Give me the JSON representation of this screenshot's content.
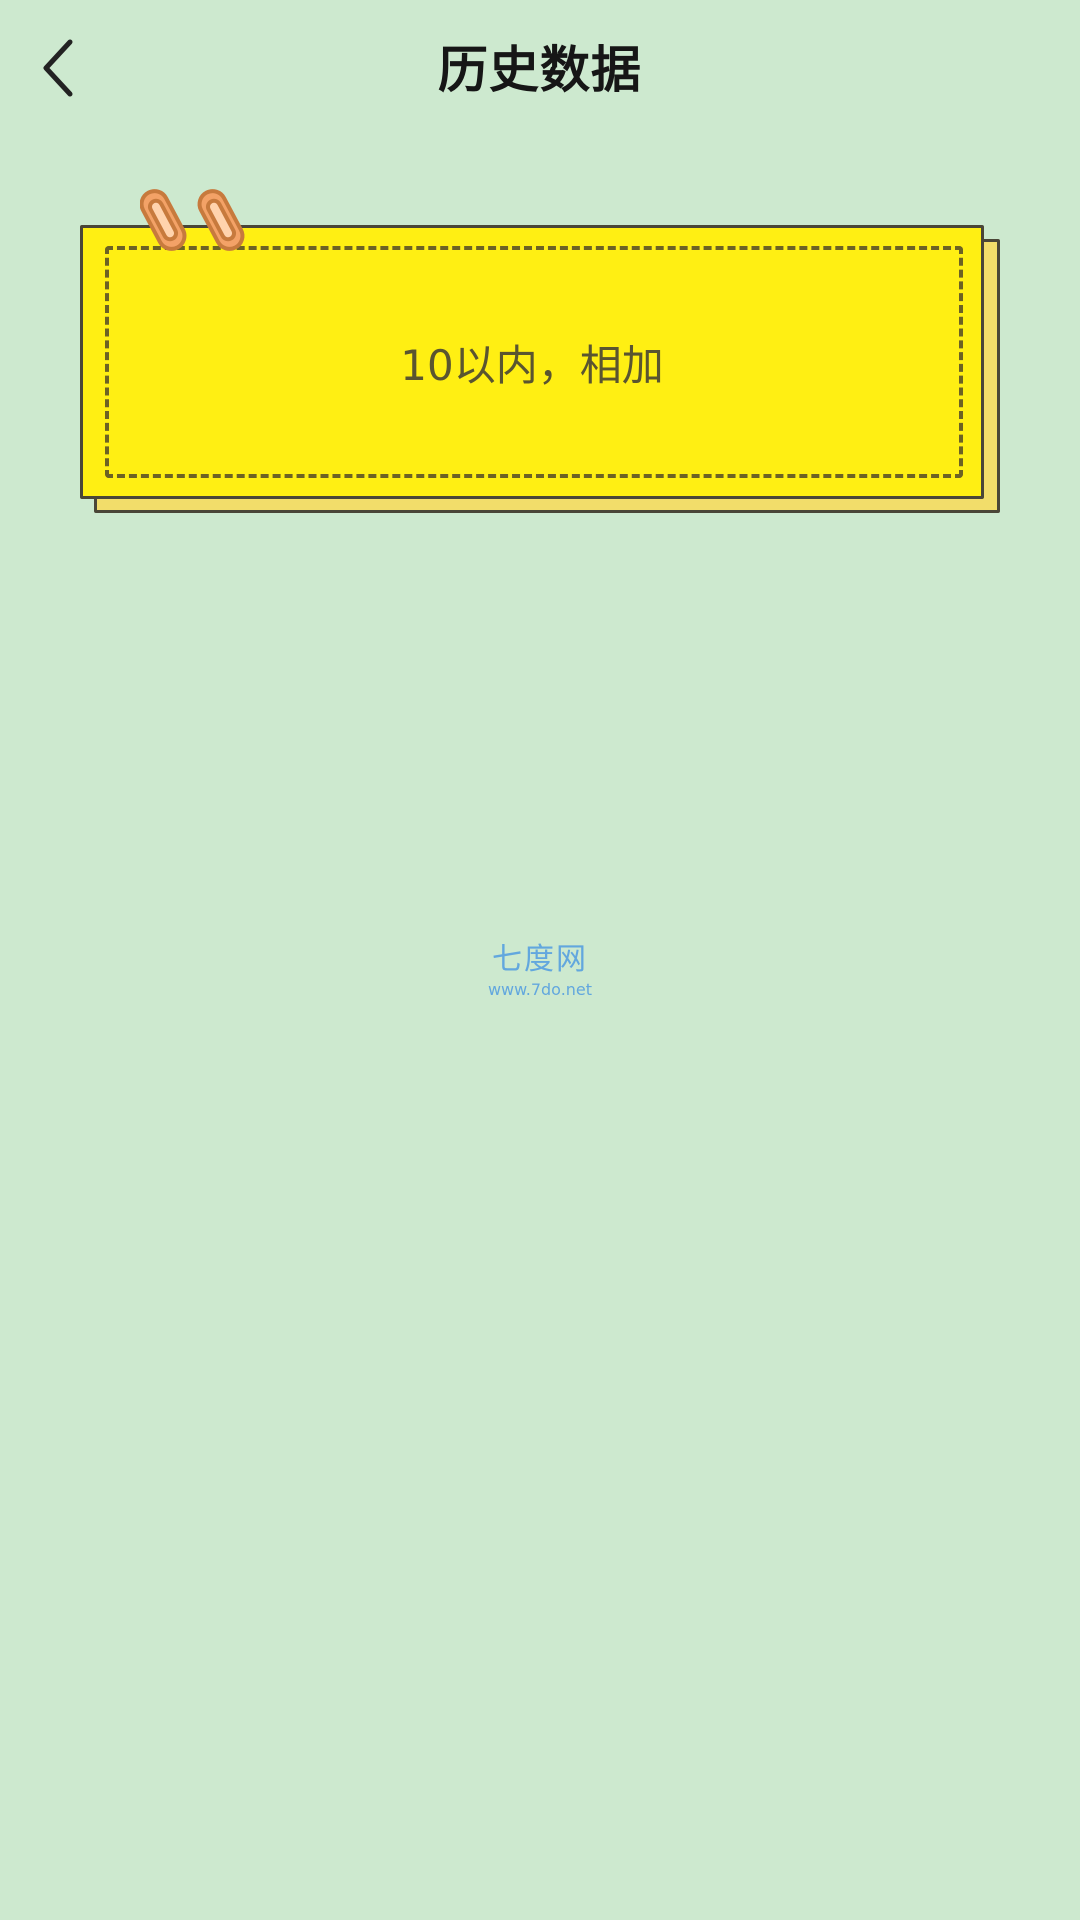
{
  "header": {
    "title": "历史数据",
    "back_icon": "chevron-left-icon"
  },
  "history": {
    "items": [
      {
        "label": "10以内，相加"
      }
    ]
  },
  "watermark": {
    "title": "七度网",
    "url": "www.7do.net"
  },
  "colors": {
    "background": "#cde9cf",
    "card_yellow": "#ffef13",
    "card_shadow": "#f2dd6a",
    "clip_orange": "#f3a267",
    "watermark_blue": "#62a7de"
  }
}
